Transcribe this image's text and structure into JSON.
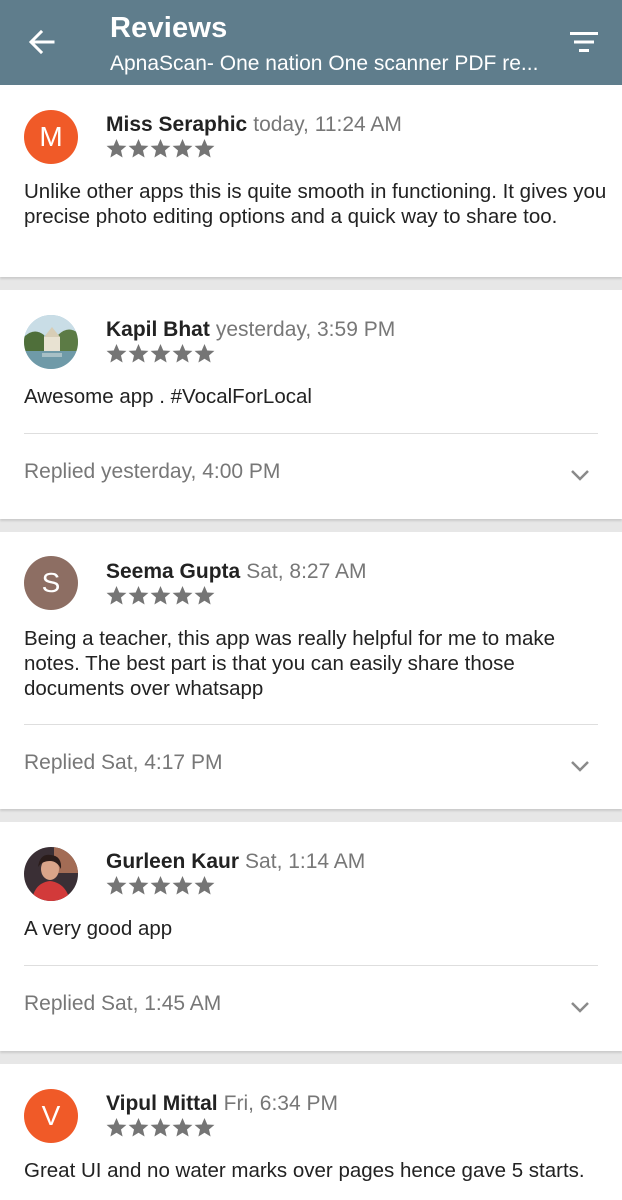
{
  "header": {
    "title": "Reviews",
    "subtitle": "ApnaScan- One nation One scanner PDF re..."
  },
  "colors": {
    "appbar": "#5f7d8c",
    "accent_orange": "#f05a28",
    "avatar_brown": "#8d6e63",
    "star_gray": "#757575"
  },
  "icons": {
    "back": "arrow-left",
    "filter": "filter-lines",
    "star": "star",
    "expand": "chevron-down"
  },
  "reviews": [
    {
      "name": "Miss Seraphic",
      "date": "today, 11:24 AM",
      "rating": 5,
      "avatar_letter": "M",
      "text": "Unlike other apps this is quite smooth in functioning. It gives you precise photo editing options and a quick way to share too.",
      "reply": ""
    },
    {
      "name": "Kapil Bhat",
      "date": "yesterday, 3:59 PM",
      "rating": 5,
      "avatar_letter": "",
      "text": "Awesome app . #VocalForLocal",
      "reply": "Replied yesterday, 4:00 PM"
    },
    {
      "name": "Seema Gupta",
      "date": "Sat, 8:27 AM",
      "rating": 5,
      "avatar_letter": "S",
      "text": "Being a teacher, this app was really helpful for me to make notes. The best part is that you can easily share those documents over whatsapp",
      "reply": "Replied Sat, 4:17 PM"
    },
    {
      "name": "Gurleen Kaur",
      "date": "Sat, 1:14 AM",
      "rating": 5,
      "avatar_letter": "",
      "text": "A very good app",
      "reply": "Replied Sat, 1:45 AM"
    },
    {
      "name": "Vipul Mittal",
      "date": "Fri, 6:34 PM",
      "rating": 5,
      "avatar_letter": "V",
      "text": "Great UI and no water marks over pages hence gave 5 starts.",
      "reply": ""
    }
  ]
}
